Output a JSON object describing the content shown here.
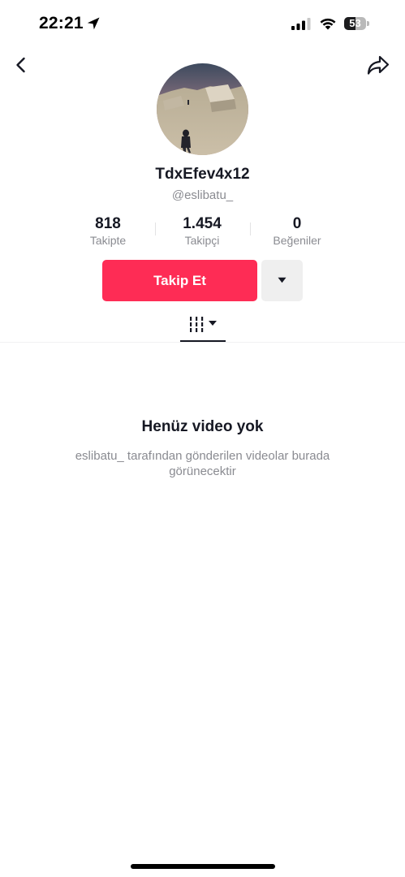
{
  "status_bar": {
    "time": "22:21",
    "battery_level": "53",
    "battery_fraction": 0.53
  },
  "header": {
    "back_icon": "chevron-left-icon",
    "share_icon": "share-arrow-icon"
  },
  "profile": {
    "display_name": "TdxEfev4x12",
    "username": "@eslibatu_"
  },
  "stats": [
    {
      "value": "818",
      "label": "Takipte"
    },
    {
      "value": "1.454",
      "label": "Takipçi"
    },
    {
      "value": "0",
      "label": "Beğeniler"
    }
  ],
  "actions": {
    "follow_label": "Takip Et",
    "more_icon": "caret-down-icon"
  },
  "tabs": {
    "grid_icon": "video-grid-icon"
  },
  "empty_state": {
    "title": "Henüz video yok",
    "description": "eslibatu_ tarafından gönderilen videolar burada görünecektir"
  },
  "colors": {
    "primary": "#fe2c55",
    "text": "#161823",
    "secondary_text": "#8a8b91"
  }
}
